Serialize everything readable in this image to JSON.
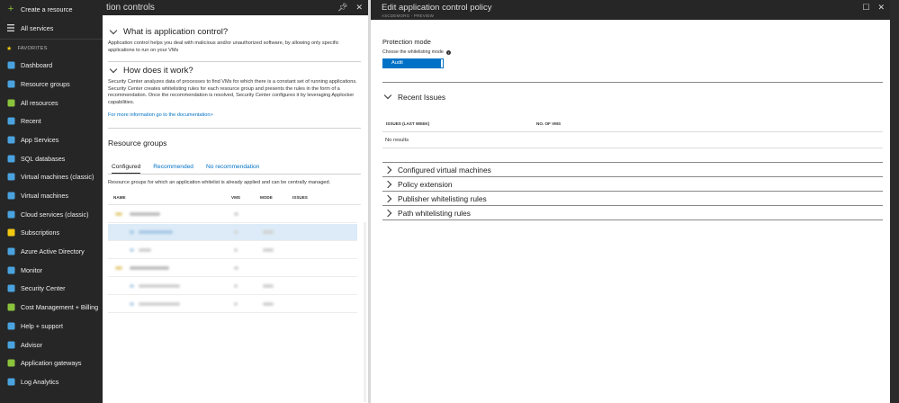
{
  "sidebar": {
    "top_items": [
      {
        "label": "Create a resource",
        "icon": "plus-icon"
      },
      {
        "label": "All services",
        "icon": "list-icon"
      }
    ],
    "favorites_label": "FAVORITES",
    "items": [
      {
        "label": "Dashboard",
        "icon": "dashboard-icon",
        "color": "#4aa3df"
      },
      {
        "label": "Resource groups",
        "icon": "resource-groups-icon",
        "color": "#4aa3df"
      },
      {
        "label": "All resources",
        "icon": "all-resources-icon",
        "color": "#8ac33c"
      },
      {
        "label": "Recent",
        "icon": "clock-icon",
        "color": "#4aa3df"
      },
      {
        "label": "App Services",
        "icon": "app-services-icon",
        "color": "#4aa3df"
      },
      {
        "label": "SQL databases",
        "icon": "sql-icon",
        "color": "#4aa3df"
      },
      {
        "label": "Virtual machines (classic)",
        "icon": "vm-classic-icon",
        "color": "#4aa3df"
      },
      {
        "label": "Virtual machines",
        "icon": "vm-icon",
        "color": "#4aa3df"
      },
      {
        "label": "Cloud services (classic)",
        "icon": "cloud-icon",
        "color": "#4aa3df"
      },
      {
        "label": "Subscriptions",
        "icon": "key-icon",
        "color": "#f2c811"
      },
      {
        "label": "Azure Active Directory",
        "icon": "aad-icon",
        "color": "#4aa3df"
      },
      {
        "label": "Monitor",
        "icon": "monitor-icon",
        "color": "#4aa3df"
      },
      {
        "label": "Security Center",
        "icon": "shield-icon",
        "color": "#4aa3df"
      },
      {
        "label": "Cost Management + Billing",
        "icon": "billing-icon",
        "color": "#8ac33c"
      },
      {
        "label": "Help + support",
        "icon": "help-icon",
        "color": "#4aa3df"
      },
      {
        "label": "Advisor",
        "icon": "advisor-icon",
        "color": "#4aa3df"
      },
      {
        "label": "Application gateways",
        "icon": "gateway-icon",
        "color": "#8ac33c"
      },
      {
        "label": "Log Analytics",
        "icon": "analytics-icon",
        "color": "#4aa3df"
      }
    ]
  },
  "blade1": {
    "title": "tion controls",
    "what_title": "What is application control?",
    "what_text": "Application control helps you deal with malicious and/or unauthorized software, by allowing only specific applications to run on your VMs",
    "how_title": "How does it work?",
    "how_text": "Security Center analyzes data of processes to find VMs for which there is a constant set of running applications. Security Center creates whitelisting rules for each resource group and presents the rules in the form of a recommendation. Once the recommendation is resolved, Security Center configures it by leveraging Applocker capabilities.",
    "doc_link": "For more information go to the documentation>",
    "rg_title": "Resource groups",
    "tabs": [
      "Configured",
      "Recommended",
      "No recommendation"
    ],
    "rg_desc": "Resource groups for which an application whitelist is already applied and can be centrally managed.",
    "columns": [
      "NAME",
      "VMS",
      "MODE",
      "ISSUES"
    ]
  },
  "blade2": {
    "title": "Edit application control policy",
    "subtitle": "ASCDEMORG - PREVIEW",
    "protection_label": "Protection mode",
    "whitelist_label": "Choose the whitelisting mode",
    "audit_label": "Audit",
    "recent_title": "Recent Issues",
    "col_issues": "ISSUES (LAST WEEK)",
    "col_vms": "NO. OF VMS",
    "no_results": "No results",
    "sections": [
      "Configured virtual machines",
      "Policy extension",
      "Publisher whitelisting rules",
      "Path whitelisting rules"
    ]
  }
}
